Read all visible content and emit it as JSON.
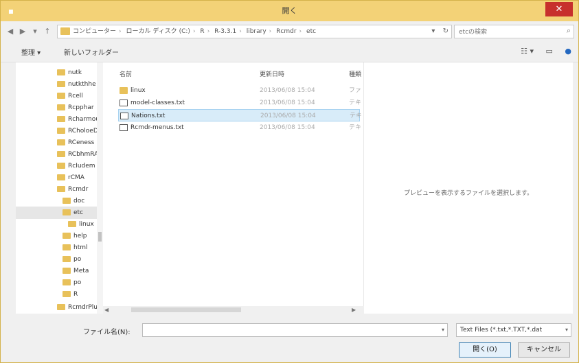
{
  "window": {
    "title": "開く",
    "close_glyph": "✕"
  },
  "address": {
    "crumbs": [
      "コンピューター",
      "ローカル ディスク (C:)",
      "R",
      "R-3.3.1",
      "library",
      "Rcmdr",
      "etc"
    ],
    "refresh_glyph": "↻",
    "dropdown_glyph": "▾"
  },
  "search": {
    "placeholder": "etcの検索"
  },
  "toolbar": {
    "organize_label": "整理 ▾",
    "new_folder_label": "新しいフォルダー"
  },
  "nav": {
    "items": [
      {
        "label": "nutk",
        "indent": 0
      },
      {
        "label": "nutkthhe",
        "indent": 0
      },
      {
        "label": "Rcell",
        "indent": 0
      },
      {
        "label": "Rcpphar",
        "indent": 0
      },
      {
        "label": "Rcharmou",
        "indent": 0
      },
      {
        "label": "RCholoeD",
        "indent": 0
      },
      {
        "label": "RCeness",
        "indent": 0
      },
      {
        "label": "RCbhmRA",
        "indent": 0
      },
      {
        "label": "RcIudem",
        "indent": 0
      },
      {
        "label": "rCMA",
        "indent": 0
      },
      {
        "label": "Rcmdr",
        "indent": 0
      },
      {
        "label": "doc",
        "indent": 1
      },
      {
        "label": "etc",
        "indent": 1,
        "selected": true
      },
      {
        "label": "linux",
        "indent": 2
      },
      {
        "label": "help",
        "indent": 1
      },
      {
        "label": "html",
        "indent": 1
      },
      {
        "label": "po",
        "indent": 1
      },
      {
        "label": "Meta",
        "indent": 1
      },
      {
        "label": "po",
        "indent": 1
      },
      {
        "label": "R",
        "indent": 1
      },
      {
        "label": "RcmdrPlu",
        "indent": 0
      }
    ]
  },
  "files": {
    "col_name": "名前",
    "col_date": "更新日時",
    "col_type": "種類",
    "rows": [
      {
        "name": "linux",
        "date": "2013/06/08 15:04",
        "type": "ファ",
        "kind": "folder"
      },
      {
        "name": "model-classes.txt",
        "date": "2013/06/08 15:04",
        "type": "テキ",
        "kind": "file"
      },
      {
        "name": "Nations.txt",
        "date": "2013/06/08 15:04",
        "type": "テキ",
        "kind": "file",
        "selected": true
      },
      {
        "name": "Rcmdr-menus.txt",
        "date": "2013/06/08 15:04",
        "type": "テキ",
        "kind": "file"
      }
    ]
  },
  "preview": {
    "message": "プレビューを表示するファイルを選択します。"
  },
  "bottom": {
    "filename_label": "ファイル名(N):",
    "filename_value": "",
    "filter_value": "Text Files (*.txt,*.TXT,*.dat",
    "open_label": "開く(O)",
    "cancel_label": "キャンセル"
  },
  "colors": {
    "titlebar": "#f3d277",
    "close": "#c7302c",
    "folder": "#e8c15a",
    "selection": "#d8ecf9"
  }
}
